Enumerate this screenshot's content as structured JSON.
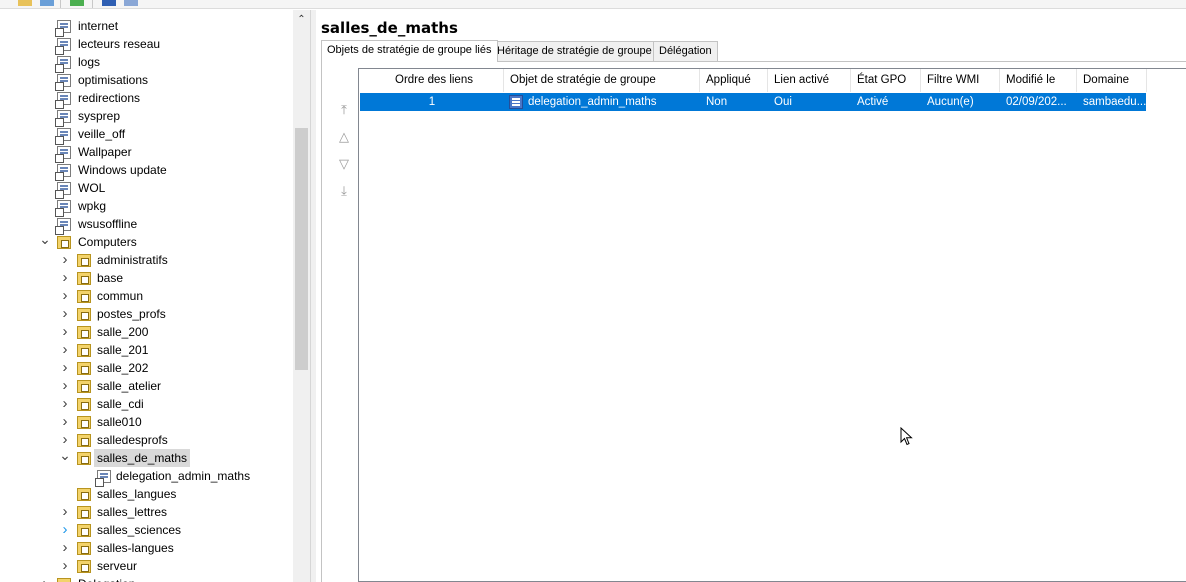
{
  "tree": {
    "items": [
      {
        "label": "internet",
        "type": "gpo",
        "level": 1
      },
      {
        "label": "lecteurs reseau",
        "type": "gpo",
        "level": 1
      },
      {
        "label": "logs",
        "type": "gpo",
        "level": 1
      },
      {
        "label": "optimisations",
        "type": "gpo",
        "level": 1
      },
      {
        "label": "redirections",
        "type": "gpo",
        "level": 1
      },
      {
        "label": "sysprep",
        "type": "gpo",
        "level": 1
      },
      {
        "label": "veille_off",
        "type": "gpo",
        "level": 1
      },
      {
        "label": "Wallpaper",
        "type": "gpo",
        "level": 1
      },
      {
        "label": "Windows update",
        "type": "gpo",
        "level": 1
      },
      {
        "label": "WOL",
        "type": "gpo",
        "level": 1
      },
      {
        "label": "wpkg",
        "type": "gpo",
        "level": 1
      },
      {
        "label": "wsusoffline",
        "type": "gpo",
        "level": 1
      },
      {
        "label": "Computers",
        "type": "ou",
        "level": 1,
        "expander": "expanded"
      },
      {
        "label": "administratifs",
        "type": "ou",
        "level": 2,
        "expander": "collapsed"
      },
      {
        "label": "base",
        "type": "ou",
        "level": 2,
        "expander": "collapsed"
      },
      {
        "label": "commun",
        "type": "ou",
        "level": 2,
        "expander": "collapsed"
      },
      {
        "label": "postes_profs",
        "type": "ou",
        "level": 2,
        "expander": "collapsed"
      },
      {
        "label": "salle_200",
        "type": "ou",
        "level": 2,
        "expander": "collapsed"
      },
      {
        "label": "salle_201",
        "type": "ou",
        "level": 2,
        "expander": "collapsed"
      },
      {
        "label": "salle_202",
        "type": "ou",
        "level": 2,
        "expander": "collapsed"
      },
      {
        "label": "salle_atelier",
        "type": "ou",
        "level": 2,
        "expander": "collapsed"
      },
      {
        "label": "salle_cdi",
        "type": "ou",
        "level": 2,
        "expander": "collapsed"
      },
      {
        "label": "salle010",
        "type": "ou",
        "level": 2,
        "expander": "collapsed"
      },
      {
        "label": "salledesprofs",
        "type": "ou",
        "level": 2,
        "expander": "collapsed"
      },
      {
        "label": "salles_de_maths",
        "type": "ou",
        "level": 2,
        "expander": "expanded",
        "selected": true
      },
      {
        "label": "delegation_admin_maths",
        "type": "gpo",
        "level": 3
      },
      {
        "label": "salles_langues",
        "type": "ou",
        "level": 2
      },
      {
        "label": "salles_lettres",
        "type": "ou",
        "level": 2,
        "expander": "collapsed"
      },
      {
        "label": "salles_sciences",
        "type": "ou",
        "level": 2,
        "expander": "collapsed-hover"
      },
      {
        "label": "salles-langues",
        "type": "ou",
        "level": 2,
        "expander": "collapsed"
      },
      {
        "label": "serveur",
        "type": "ou",
        "level": 2,
        "expander": "collapsed"
      },
      {
        "label": "Delegation",
        "type": "ou",
        "level": 1,
        "expander": "collapsed"
      }
    ]
  },
  "main": {
    "title": "salles_de_maths",
    "tabs": [
      {
        "label": "Objets de stratégie de groupe liés",
        "active": true
      },
      {
        "label": "Héritage de stratégie de groupe",
        "active": false
      },
      {
        "label": "Délégation",
        "active": false
      }
    ],
    "move_buttons": [
      {
        "name": "move-top-button",
        "glyph": "⤒"
      },
      {
        "name": "move-up-button",
        "glyph": "△"
      },
      {
        "name": "move-down-button",
        "glyph": "▽"
      },
      {
        "name": "move-bottom-button",
        "glyph": "⤓"
      }
    ],
    "columns": [
      "Ordre des liens",
      "Objet de stratégie de groupe",
      "Appliqué",
      "Lien activé",
      "État GPO",
      "Filtre WMI",
      "Modifié le",
      "Domaine"
    ],
    "rows": [
      {
        "ordre": "1",
        "gpo": "delegation_admin_maths",
        "applique": "Non",
        "lien_active": "Oui",
        "etat": "Activé",
        "filtre": "Aucun(e)",
        "modifie": "02/09/202...",
        "domaine": "sambaedu..."
      }
    ]
  },
  "colors": {
    "selection": "#0078d7",
    "tree_selection": "#d9d9d9",
    "ou_folder": "#f3d36b"
  }
}
